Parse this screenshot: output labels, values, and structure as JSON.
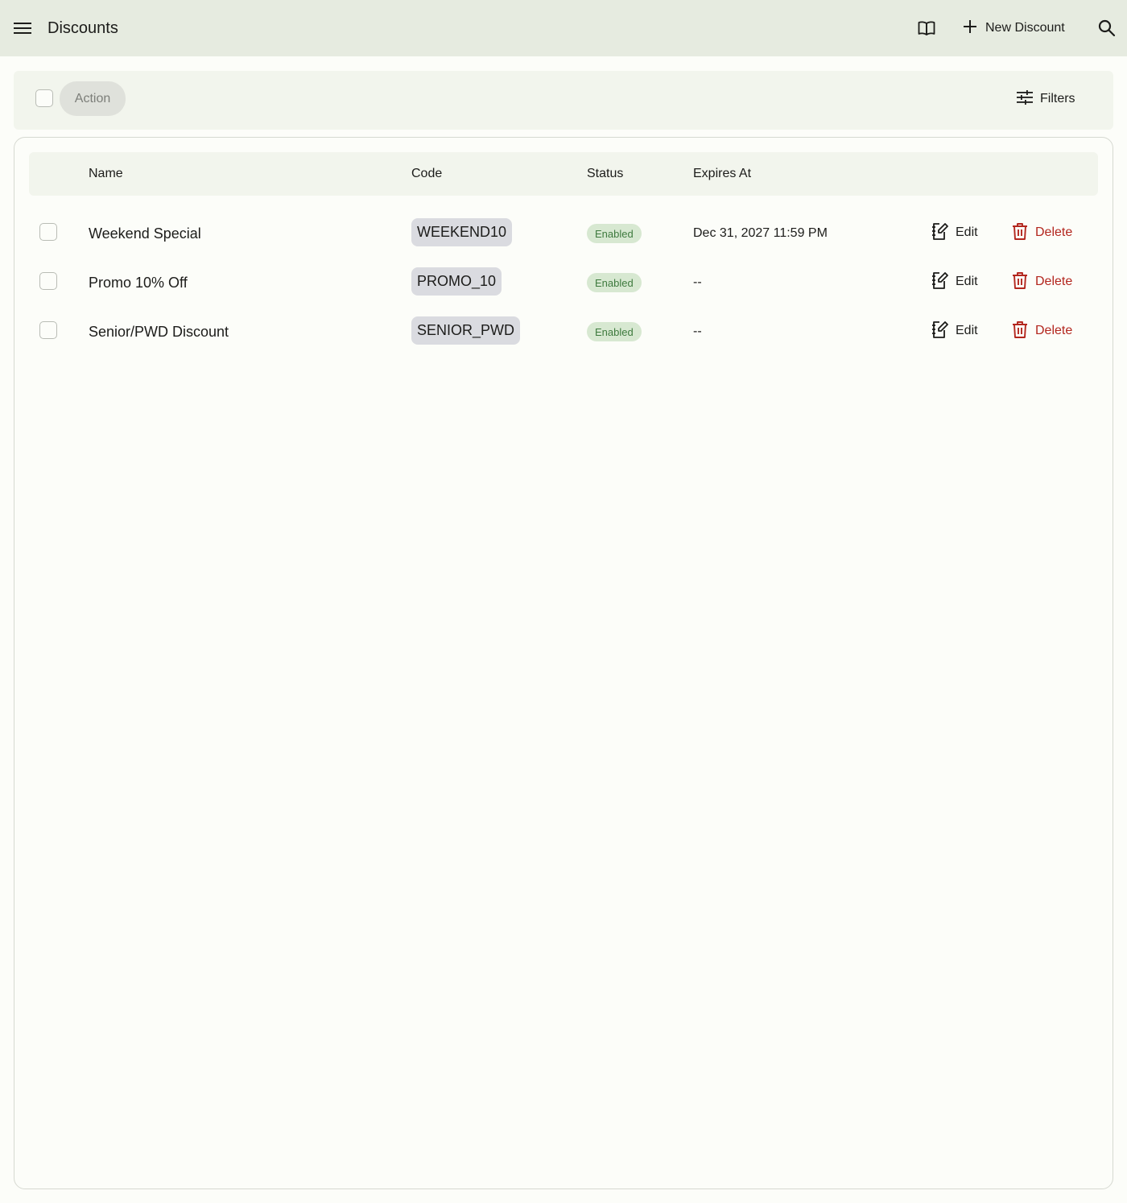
{
  "header": {
    "title": "Discounts",
    "menu_icon": "hamburger-menu-icon",
    "docs_icon": "open-book-icon",
    "new_label": "New Discount",
    "new_icon": "plus-icon",
    "search_icon": "search-icon"
  },
  "toolbar": {
    "action_label": "Action",
    "filters_label": "Filters",
    "filters_icon": "tune-sliders-icon"
  },
  "table": {
    "columns": [
      "Name",
      "Code",
      "Status",
      "Expires At"
    ],
    "rows": [
      {
        "name": "Weekend Special",
        "code": "WEEKEND10",
        "status": "Enabled",
        "expires": "Dec 31, 2027 11:59 PM",
        "edit": "Edit",
        "delete": "Delete"
      },
      {
        "name": "Promo 10% Off",
        "code": "PROMO_10",
        "status": "Enabled",
        "expires": "--",
        "edit": "Edit",
        "delete": "Delete"
      },
      {
        "name": "Senior/PWD Discount",
        "code": "SENIOR_PWD",
        "status": "Enabled",
        "expires": "--",
        "edit": "Edit",
        "delete": "Delete"
      }
    ]
  },
  "colors": {
    "topbar_bg": "#e6ebe0",
    "status_enabled_bg": "#d7e8d1",
    "status_enabled_fg": "#3e7a3e",
    "delete_fg": "#b3261e",
    "code_chip_bg": "#dadbe0"
  }
}
